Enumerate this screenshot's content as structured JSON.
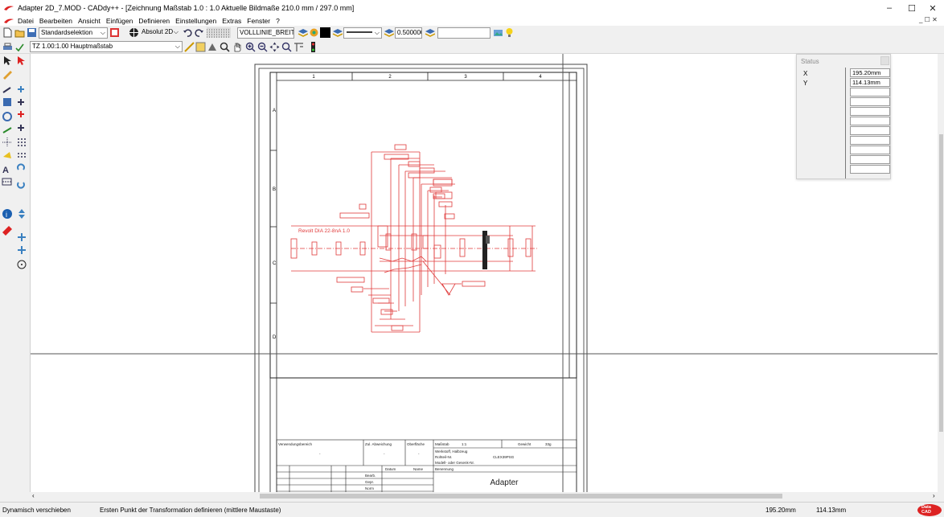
{
  "window": {
    "title": "Adapter 2D_7.MOD  -  CADdy++ - [Zeichnung   Maßstab 1.0 : 1.0   Aktuelle Bildmaße 210.0 mm / 297.0 mm]",
    "minimize": "–",
    "maximize": "☐",
    "close": "✕"
  },
  "menu": {
    "items": [
      "Datei",
      "Bearbeiten",
      "Ansicht",
      "Einfügen",
      "Definieren",
      "Einstellungen",
      "Extras",
      "Fenster",
      "?"
    ],
    "mdi_controls": "_  ☐  ✕"
  },
  "toolbar1": {
    "selection_mode": "Standardselektion",
    "coord_mode": "Absolut 2D",
    "linetype": "VOLLLINIE_BREIT",
    "line_width": "0.500000",
    "extra_input": ""
  },
  "toolbar2": {
    "scale_select": "TZ 1.00:1.00 Hauptmaßstab"
  },
  "status_panel": {
    "title": "Status",
    "labels": [
      "X",
      "Y"
    ],
    "values": [
      "195.20mm",
      "114.13mm",
      "",
      "",
      "",
      "",
      "",
      "",
      "",
      "",
      ""
    ]
  },
  "drawing": {
    "col_labels": [
      "1",
      "2",
      "3",
      "4"
    ],
    "row_labels": [
      "A",
      "B",
      "C",
      "D"
    ],
    "red_label": "Revolt DIA 22-8nA 1.0",
    "titleblock": {
      "verwendungsbereich": "Verwendungsbereich",
      "zul_abweichung": "Zul. Abweichung",
      "oberflache": "Oberfläche",
      "massstab": "Maßstab",
      "massstab_val": "1:1",
      "gewicht": "Gewicht",
      "gewicht_val": "33g",
      "werkstoff": "Werkstoff, Halbzeug",
      "rohteil": "Rohteil-Nr.",
      "rohteil_val": "CLEX39PSG",
      "modell": "Modell- oder Gesenk-Nr.",
      "datum": "Datum",
      "name": "Name",
      "benennung": "Benennung",
      "bearb": "Bearb.",
      "gepr": "Gepr.",
      "norm": "Norm",
      "dash1": "-",
      "dash2": "-",
      "dash3": "-",
      "part_name": "Adapter"
    }
  },
  "statusbar": {
    "mode": "Dynamisch verschieben",
    "hint": "Ersten Punkt der Transformation definieren (mittlere Maustaste)",
    "x": "195.20mm",
    "y": "114.13mm",
    "logo": "Data\nCAD"
  },
  "colors": {
    "accent_red": "#e02020",
    "drawing_red": "#e03a3a",
    "frame_black": "#202020"
  }
}
